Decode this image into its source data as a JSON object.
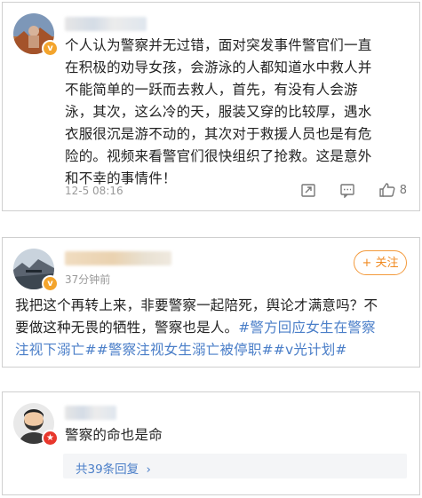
{
  "comments": [
    {
      "text": "个人认为警察并无过错，面对突发事件警官们一直在积极的劝导女孩，会游泳的人都知道水中救人并不能简单的一跃而去救人，首先，有没有人会游泳，其次，这么冷的天，服装又穿的比较厚，遇水衣服很沉是游不动的，其次对于救援人员也是有危险的。视频来看警官们很快组织了抢救。这是意外和不幸的事情件！",
      "lines": [
        "个人认为警察并无过错，面对突发事件警官们一直",
        "在积极的劝导女孩，会游泳的人都知道水中救人并",
        "不能简单的一跃而去救人，首先，有没有人会游",
        "泳，其次，这么冷的天，服装又穿的比较厚，遇水",
        "衣服很沉是游不动的，其次对于救援人员也是有危",
        "险的。视频来看警官们很快组织了抢救。这是意外",
        "和不幸的事情件！"
      ],
      "timestamp": "12-5 08:16",
      "like_count": "8",
      "badge": "v"
    },
    {
      "lines": [
        "我把这个再转上来，非要警察一起陪死，舆论才满意吗？不",
        "要做这种无畏的牺牲，警察也是人。",
        "注视下溺亡##警察注视女生溺亡被停职##v光计划#"
      ],
      "line2_hashtag": "#警方回应女生在警察",
      "timestamp": "37分钟前",
      "follow_label": "+ 关注",
      "badge": "v"
    },
    {
      "text": "警察的命也是命",
      "reply_label": "共39条回复",
      "reply_chevron": "›",
      "badge": "flag"
    }
  ],
  "icons": [
    "repost-icon",
    "comment-icon",
    "like-icon",
    "chevron-right-icon"
  ],
  "colors": {
    "link": "#4a7ec8",
    "follow": "#f08a20",
    "badge_orange": "#f3a42c",
    "badge_red": "#e8372c"
  }
}
